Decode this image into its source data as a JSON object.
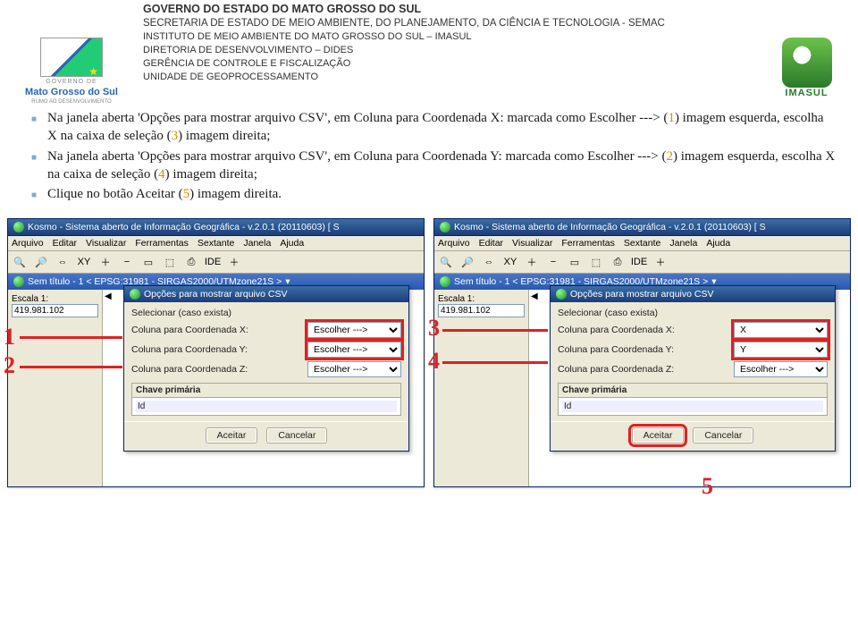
{
  "gov_header": {
    "l1": "GOVERNO DO ESTADO DO MATO GROSSO DO SUL",
    "l2": "SECRETARIA DE ESTADO DE MEIO AMBIENTE, DO PLANEJAMENTO, DA CIÊNCIA E TECNOLOGIA - SEMAC",
    "l3": "INSTITUTO DE MEIO AMBIENTE DO MATO GROSSO DO SUL – IMASUL",
    "l4": "DIRETORIA DE DESENVOLVIMENTO – DIDES",
    "l5": "GERÊNCIA DE CONTROLE E FISCALIZAÇÃO",
    "l6": "UNIDADE DE GEOPROCESSAMENTO"
  },
  "logo_left": {
    "small": "GOVERNO DE",
    "main": "Mato Grosso do Sul",
    "tag": "RUMO AO DESENVOLVIMENTO"
  },
  "logo_right": {
    "text": "IMASUL"
  },
  "bullets": {
    "b1a": "Na janela aberta 'Opções para mostrar arquivo CSV', em Coluna para Coordenada X: marcada como Escolher ---> (",
    "b1n": "1",
    "b1b": ") imagem esquerda, escolha X na caixa de seleção (",
    "b1n2": "3",
    "b1c": ") imagem direita;",
    "b2a": "Na janela aberta 'Opções para mostrar arquivo CSV', em Coluna para Coordenada Y: marcada como Escolher ---> (",
    "b2n": "2",
    "b2b": ") imagem esquerda, escolha X na caixa de seleção (",
    "b2n2": "4",
    "b2c": ") imagem direita;",
    "b3a": "Clique no botão Aceitar (",
    "b3n": "5",
    "b3b": ") imagem direita."
  },
  "app": {
    "title": "Kosmo - Sistema aberto de Informação Geográfica - v.2.0.1 (20110603) [ S",
    "menu": [
      "Arquivo",
      "Editar",
      "Visualizar",
      "Ferramentas",
      "Sextante",
      "Janela",
      "Ajuda"
    ],
    "tab": "Sem título - 1 < EPSG:31981 - SIRGAS2000/UTMzone21S >",
    "scale_label": "Escala 1:",
    "scale_value": "419.981.102",
    "toolbar_icons": [
      "🔍",
      "🔎",
      "⇔",
      "XY",
      "＋",
      "−",
      "▭",
      "⬚",
      "⎙",
      "IDE",
      "＋"
    ]
  },
  "dialog": {
    "title": "Opções para mostrar arquivo CSV",
    "sel_lbl": "Selecionar (caso exista)",
    "rowX": "Coluna para Coordenada X:",
    "rowY": "Coluna para Coordenada Y:",
    "rowZ": "Coluna para Coordenada Z:",
    "escolher": "Escolher --->",
    "val_x": "X",
    "val_y": "Y",
    "chave": "Chave primária",
    "id": "Id",
    "btn_ok": "Aceitar",
    "btn_cancel": "Cancelar"
  },
  "annot": {
    "n1": "1",
    "n2": "2",
    "n3": "3",
    "n4": "4",
    "n5": "5"
  }
}
